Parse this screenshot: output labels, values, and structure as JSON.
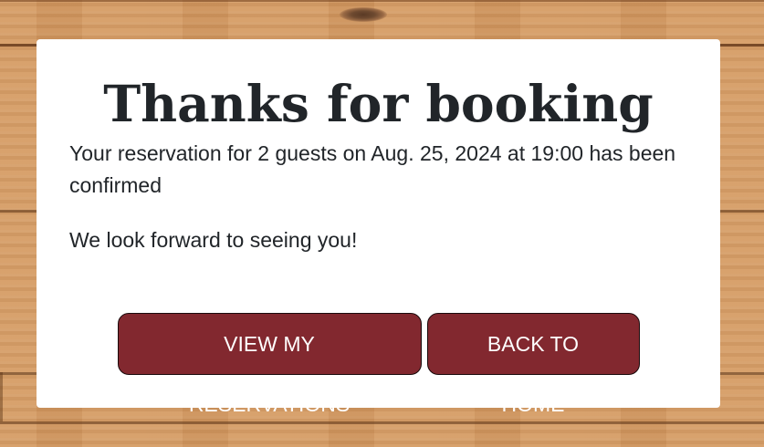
{
  "confirmation": {
    "title": "Thanks for booking",
    "message": "Your reservation for 2 guests on Aug. 25, 2024 at 19:00 has been confirmed",
    "followup": "We look forward to seeing you!"
  },
  "actions": {
    "view_reservations_label": "VIEW MY RESERVATIONS",
    "back_home_label": "BACK TO HOME"
  },
  "colors": {
    "button_background": "#82282f",
    "button_text": "#ffffff",
    "card_background": "#ffffff",
    "text": "#212529"
  }
}
